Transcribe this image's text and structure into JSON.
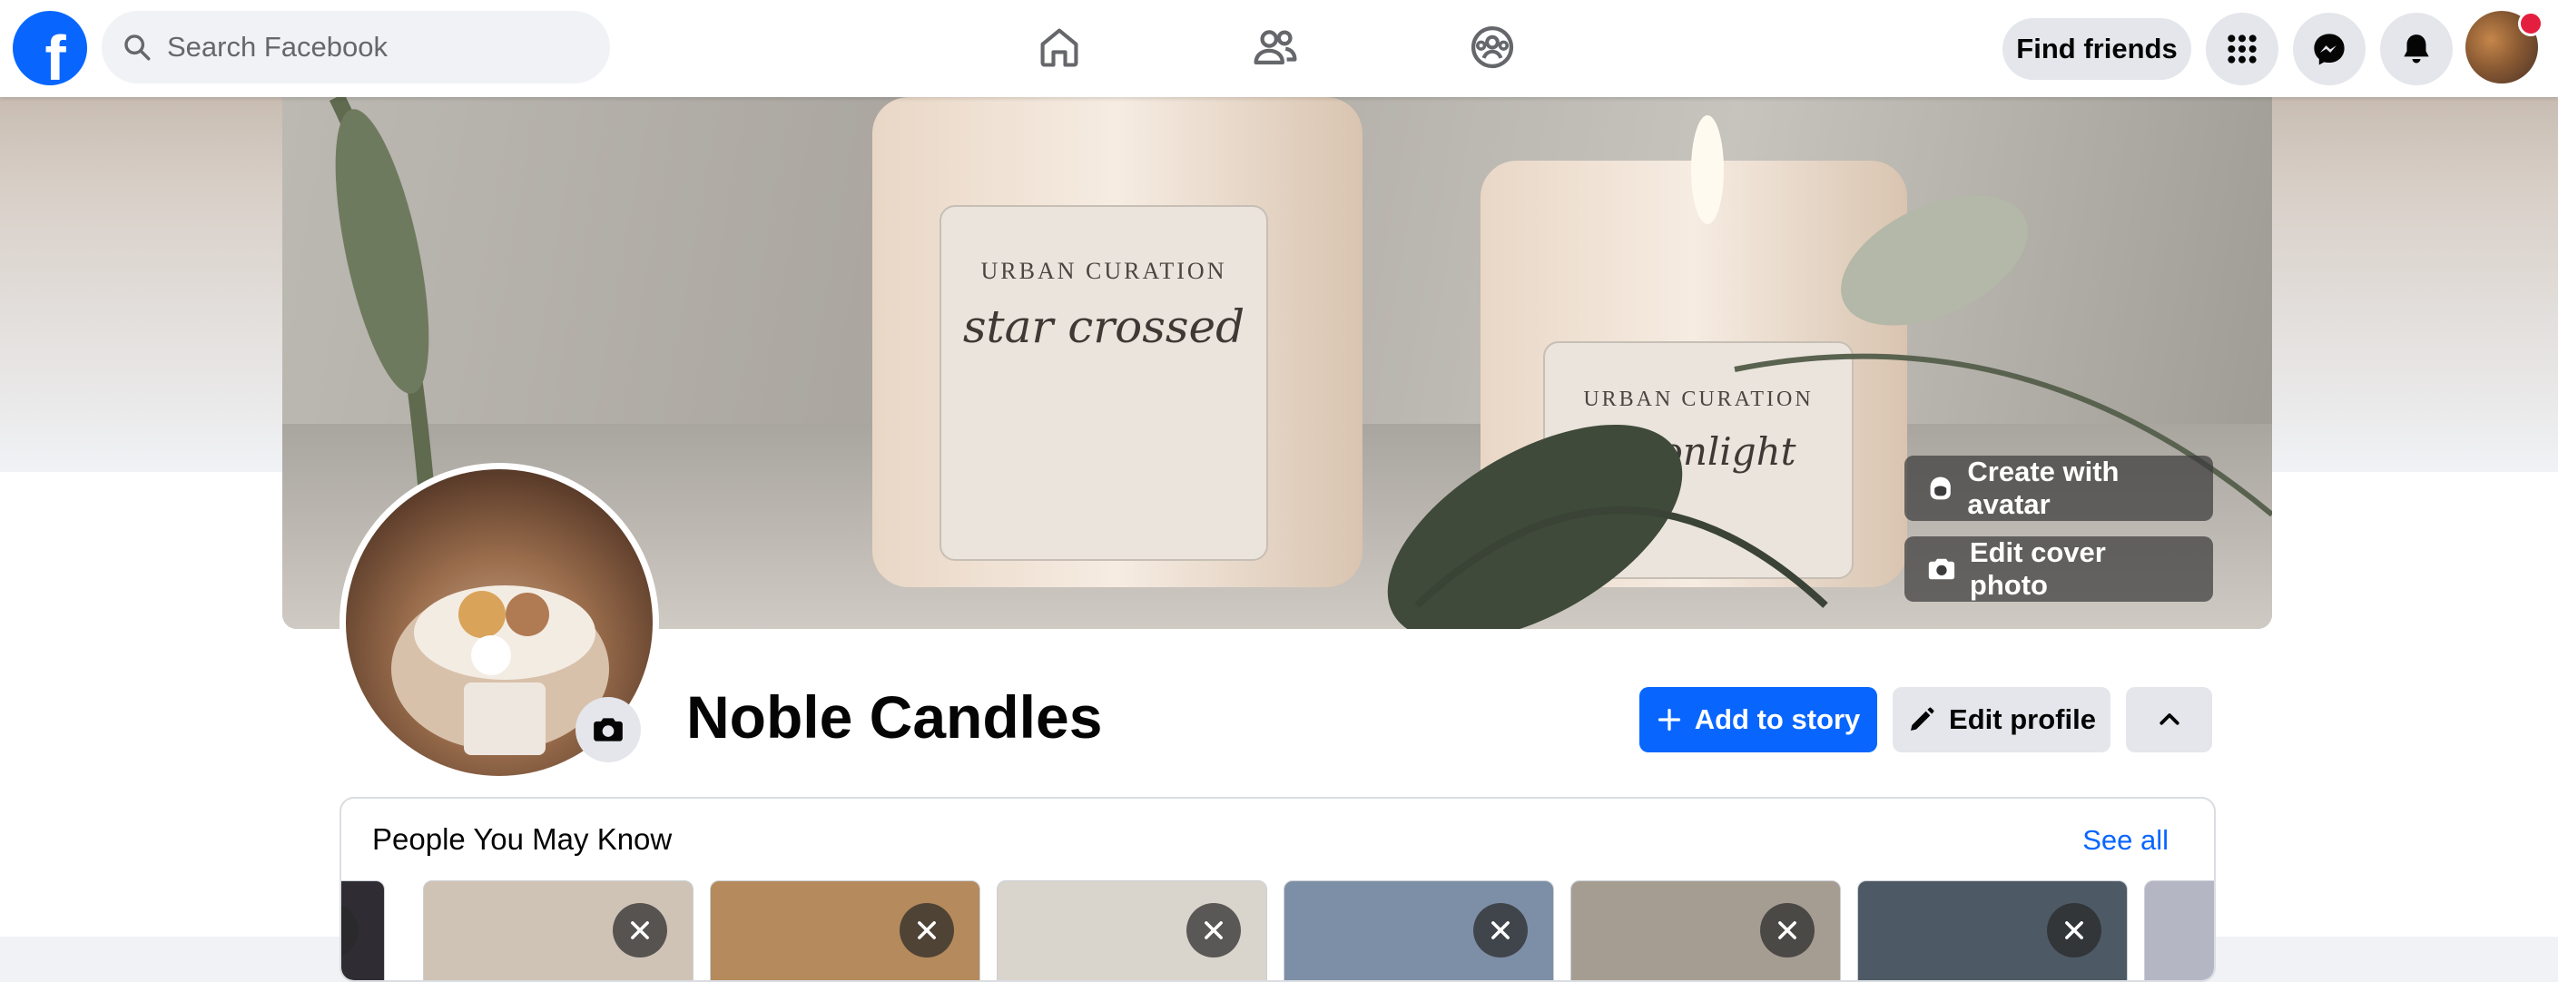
{
  "topbar": {
    "logo_letter": "f",
    "search_placeholder": "Search Facebook",
    "find_friends_label": "Find friends",
    "nav_icons": [
      "home-icon",
      "friends-icon",
      "groups-icon"
    ],
    "right_icons": [
      "menu-grid-icon",
      "messenger-icon",
      "bell-icon"
    ],
    "notification_color": "#e41e3f"
  },
  "cover": {
    "create_avatar_label": "Create with avatar",
    "edit_cover_label": "Edit cover photo",
    "jar_left_brand": "URBAN CURATION",
    "jar_left_name": "star crossed",
    "jar_right_brand": "URBAN CURATION",
    "jar_right_name": "moonlight"
  },
  "profile": {
    "name": "Noble Candles",
    "add_story_label": "Add to story",
    "edit_profile_label": "Edit profile"
  },
  "pymk": {
    "title": "People You May Know",
    "see_all_label": "See all",
    "cards": [
      {
        "color": "#2f2d33"
      },
      {
        "color": "#cfc3b6"
      },
      {
        "color": "#b58a5c"
      },
      {
        "color": "#d9d4cc"
      },
      {
        "color": "#7d8fa6"
      },
      {
        "color": "#a69d92"
      },
      {
        "color": "#4d5a66"
      },
      {
        "color": "#b4b6c4"
      }
    ]
  },
  "colors": {
    "brand": "#0866ff",
    "button_gray": "#e4e6eb",
    "page_bg": "#f0f2f5"
  }
}
